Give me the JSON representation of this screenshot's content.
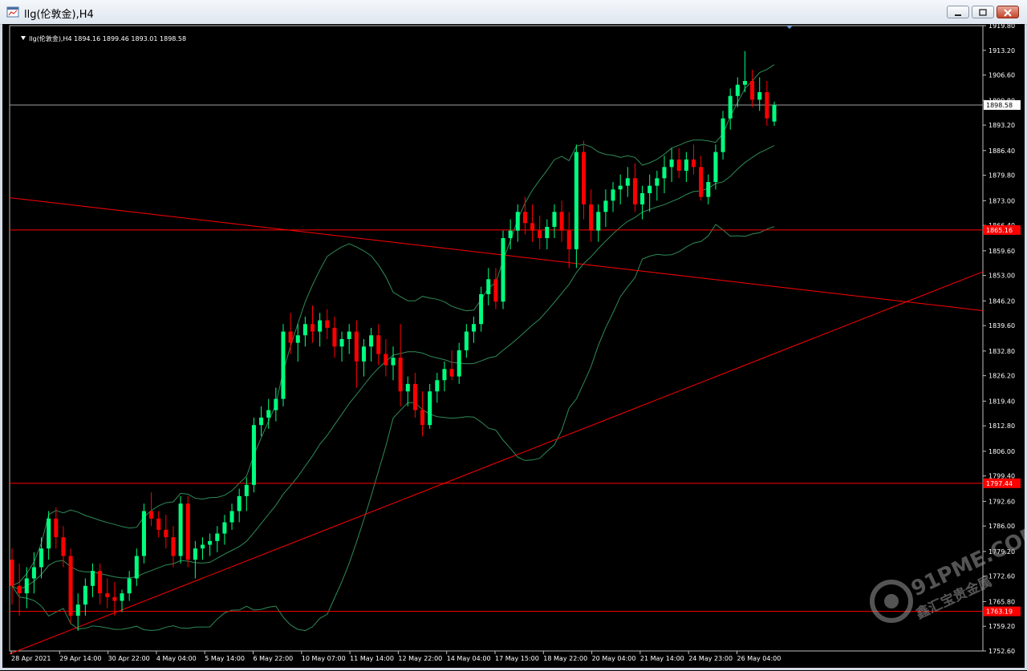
{
  "window": {
    "title": "llg(伦敦金),H4"
  },
  "chart_header": {
    "collapse_arrow": "triangle-down-icon",
    "symbol": "llg(伦敦金),H4",
    "ohlc": "1894.16 1899.46 1893.01 1898.58"
  },
  "price_axis": {
    "labels": [
      "1919.80",
      "1913.20",
      "1906.60",
      "1899.80",
      "1893.20",
      "1886.40",
      "1879.80",
      "1873.00",
      "1866.40",
      "1859.60",
      "1853.00",
      "1846.20",
      "1839.60",
      "1832.80",
      "1826.20",
      "1819.40",
      "1812.80",
      "1806.00",
      "1799.40",
      "1792.60",
      "1786.00",
      "1779.20",
      "1772.60",
      "1765.80",
      "1759.20",
      "1752.60"
    ],
    "current_price": "1898.58",
    "hline_labels": [
      "1865.16",
      "1797.44",
      "1763.19"
    ]
  },
  "time_axis": {
    "labels": [
      "28 Apr 2021",
      "29 Apr 14:00",
      "30 Apr 22:00",
      "4 May 04:00",
      "5 May 14:00",
      "6 May 22:00",
      "10 May 07:00",
      "11 May 14:00",
      "12 May 22:00",
      "14 May 04:00",
      "17 May 15:00",
      "18 May 22:00",
      "20 May 04:00",
      "21 May 14:00",
      "24 May 23:00",
      "26 May 04:00"
    ]
  },
  "watermark": {
    "brand": "91PME.COM",
    "tagline": "鑫汇宝贵金属"
  },
  "colors": {
    "bull": "#00ff7f",
    "bear": "#ff0000",
    "band": "#2e8b57",
    "hline": "#ff0000",
    "grid_text": "#ffffff"
  },
  "chart_data": {
    "type": "candlestick",
    "symbol": "llg(伦敦金)",
    "timeframe": "H4",
    "ylim": [
      1752.6,
      1919.8
    ],
    "horizontal_lines": [
      1898.58,
      1865.16,
      1797.44,
      1763.19
    ],
    "trendlines": [
      {
        "from_date": "28 Apr 2021",
        "from_price": 1873.8,
        "to_end_price": 1843.6
      },
      {
        "from_date": "28 Apr 2021",
        "from_price": 1751.8,
        "to_end_price": 1854.0
      }
    ],
    "candles": [
      [
        1777,
        1780,
        1765,
        1770
      ],
      [
        1770,
        1776,
        1762,
        1768
      ],
      [
        1768,
        1775,
        1764,
        1772
      ],
      [
        1772,
        1779,
        1768,
        1775
      ],
      [
        1775,
        1783,
        1772,
        1780
      ],
      [
        1780,
        1790,
        1777,
        1788
      ],
      [
        1788,
        1791,
        1780,
        1783
      ],
      [
        1783,
        1786,
        1775,
        1778
      ],
      [
        1778,
        1780,
        1760,
        1762
      ],
      [
        1762,
        1768,
        1758,
        1765
      ],
      [
        1765,
        1772,
        1762,
        1770
      ],
      [
        1770,
        1776,
        1767,
        1774
      ],
      [
        1774,
        1776,
        1765,
        1768
      ],
      [
        1768,
        1772,
        1764,
        1767
      ],
      [
        1767,
        1771,
        1762,
        1766
      ],
      [
        1766,
        1769,
        1763,
        1768
      ],
      [
        1768,
        1774,
        1766,
        1772
      ],
      [
        1772,
        1780,
        1770,
        1778
      ],
      [
        1778,
        1792,
        1776,
        1790
      ],
      [
        1790,
        1795,
        1786,
        1788
      ],
      [
        1788,
        1790,
        1783,
        1785
      ],
      [
        1785,
        1789,
        1780,
        1783
      ],
      [
        1783,
        1786,
        1775,
        1778
      ],
      [
        1778,
        1794,
        1776,
        1792
      ],
      [
        1792,
        1794,
        1775,
        1777
      ],
      [
        1777,
        1782,
        1772,
        1780
      ],
      [
        1780,
        1783,
        1777,
        1781
      ],
      [
        1781,
        1784,
        1778,
        1782
      ],
      [
        1782,
        1786,
        1779,
        1784
      ],
      [
        1784,
        1789,
        1781,
        1787
      ],
      [
        1787,
        1792,
        1785,
        1790
      ],
      [
        1790,
        1796,
        1787,
        1794
      ],
      [
        1794,
        1799,
        1790,
        1797
      ],
      [
        1797,
        1815,
        1795,
        1813
      ],
      [
        1813,
        1818,
        1810,
        1815
      ],
      [
        1815,
        1820,
        1812,
        1817
      ],
      [
        1817,
        1823,
        1814,
        1820
      ],
      [
        1820,
        1840,
        1818,
        1838
      ],
      [
        1838,
        1843,
        1832,
        1835
      ],
      [
        1835,
        1840,
        1830,
        1837
      ],
      [
        1837,
        1842,
        1834,
        1840
      ],
      [
        1840,
        1845,
        1835,
        1838
      ],
      [
        1838,
        1843,
        1834,
        1841
      ],
      [
        1841,
        1844,
        1836,
        1839
      ],
      [
        1839,
        1842,
        1831,
        1834
      ],
      [
        1834,
        1838,
        1830,
        1836
      ],
      [
        1836,
        1840,
        1832,
        1838
      ],
      [
        1838,
        1841,
        1823,
        1830
      ],
      [
        1830,
        1836,
        1826,
        1834
      ],
      [
        1834,
        1839,
        1830,
        1837
      ],
      [
        1837,
        1840,
        1829,
        1832
      ],
      [
        1832,
        1836,
        1826,
        1829
      ],
      [
        1829,
        1834,
        1825,
        1831
      ],
      [
        1831,
        1840,
        1818,
        1822
      ],
      [
        1822,
        1826,
        1818,
        1824
      ],
      [
        1824,
        1827,
        1815,
        1817
      ],
      [
        1817,
        1822,
        1810,
        1813
      ],
      [
        1813,
        1824,
        1812,
        1822
      ],
      [
        1822,
        1827,
        1819,
        1825
      ],
      [
        1825,
        1830,
        1822,
        1828
      ],
      [
        1828,
        1833,
        1825,
        1826
      ],
      [
        1826,
        1835,
        1824,
        1833
      ],
      [
        1833,
        1840,
        1831,
        1838
      ],
      [
        1838,
        1842,
        1835,
        1840
      ],
      [
        1840,
        1850,
        1838,
        1848
      ],
      [
        1848,
        1855,
        1845,
        1852
      ],
      [
        1852,
        1855,
        1844,
        1846
      ],
      [
        1846,
        1865,
        1844,
        1863
      ],
      [
        1863,
        1868,
        1860,
        1865
      ],
      [
        1865,
        1872,
        1862,
        1870
      ],
      [
        1870,
        1874,
        1864,
        1867
      ],
      [
        1867,
        1872,
        1862,
        1865
      ],
      [
        1865,
        1869,
        1860,
        1863
      ],
      [
        1863,
        1868,
        1860,
        1866
      ],
      [
        1866,
        1872,
        1863,
        1870
      ],
      [
        1870,
        1873,
        1862,
        1865
      ],
      [
        1865,
        1870,
        1855,
        1860
      ],
      [
        1860,
        1888,
        1855,
        1886
      ],
      [
        1886,
        1889,
        1868,
        1872
      ],
      [
        1872,
        1876,
        1862,
        1865
      ],
      [
        1865,
        1872,
        1862,
        1870
      ],
      [
        1870,
        1876,
        1866,
        1873
      ],
      [
        1873,
        1878,
        1870,
        1876
      ],
      [
        1876,
        1880,
        1872,
        1877
      ],
      [
        1877,
        1882,
        1874,
        1879
      ],
      [
        1879,
        1883,
        1870,
        1872
      ],
      [
        1872,
        1877,
        1868,
        1875
      ],
      [
        1875,
        1880,
        1870,
        1877
      ],
      [
        1877,
        1881,
        1873,
        1879
      ],
      [
        1879,
        1885,
        1875,
        1882
      ],
      [
        1882,
        1887,
        1878,
        1884
      ],
      [
        1884,
        1887,
        1879,
        1881
      ],
      [
        1881,
        1886,
        1878,
        1884
      ],
      [
        1884,
        1888,
        1880,
        1882
      ],
      [
        1882,
        1885,
        1873,
        1874
      ],
      [
        1874,
        1880,
        1872,
        1878
      ],
      [
        1878,
        1888,
        1876,
        1886
      ],
      [
        1886,
        1897,
        1884,
        1895
      ],
      [
        1895,
        1903,
        1892,
        1901
      ],
      [
        1901,
        1906,
        1898,
        1904
      ],
      [
        1904,
        1913,
        1902,
        1905
      ],
      [
        1905,
        1908,
        1898,
        1900
      ],
      [
        1900,
        1906,
        1897,
        1902
      ],
      [
        1902,
        1905,
        1893,
        1895
      ],
      [
        1894.16,
        1899.46,
        1893.01,
        1898.58
      ]
    ],
    "bollinger": {
      "period": 20,
      "deviations": 2
    }
  }
}
